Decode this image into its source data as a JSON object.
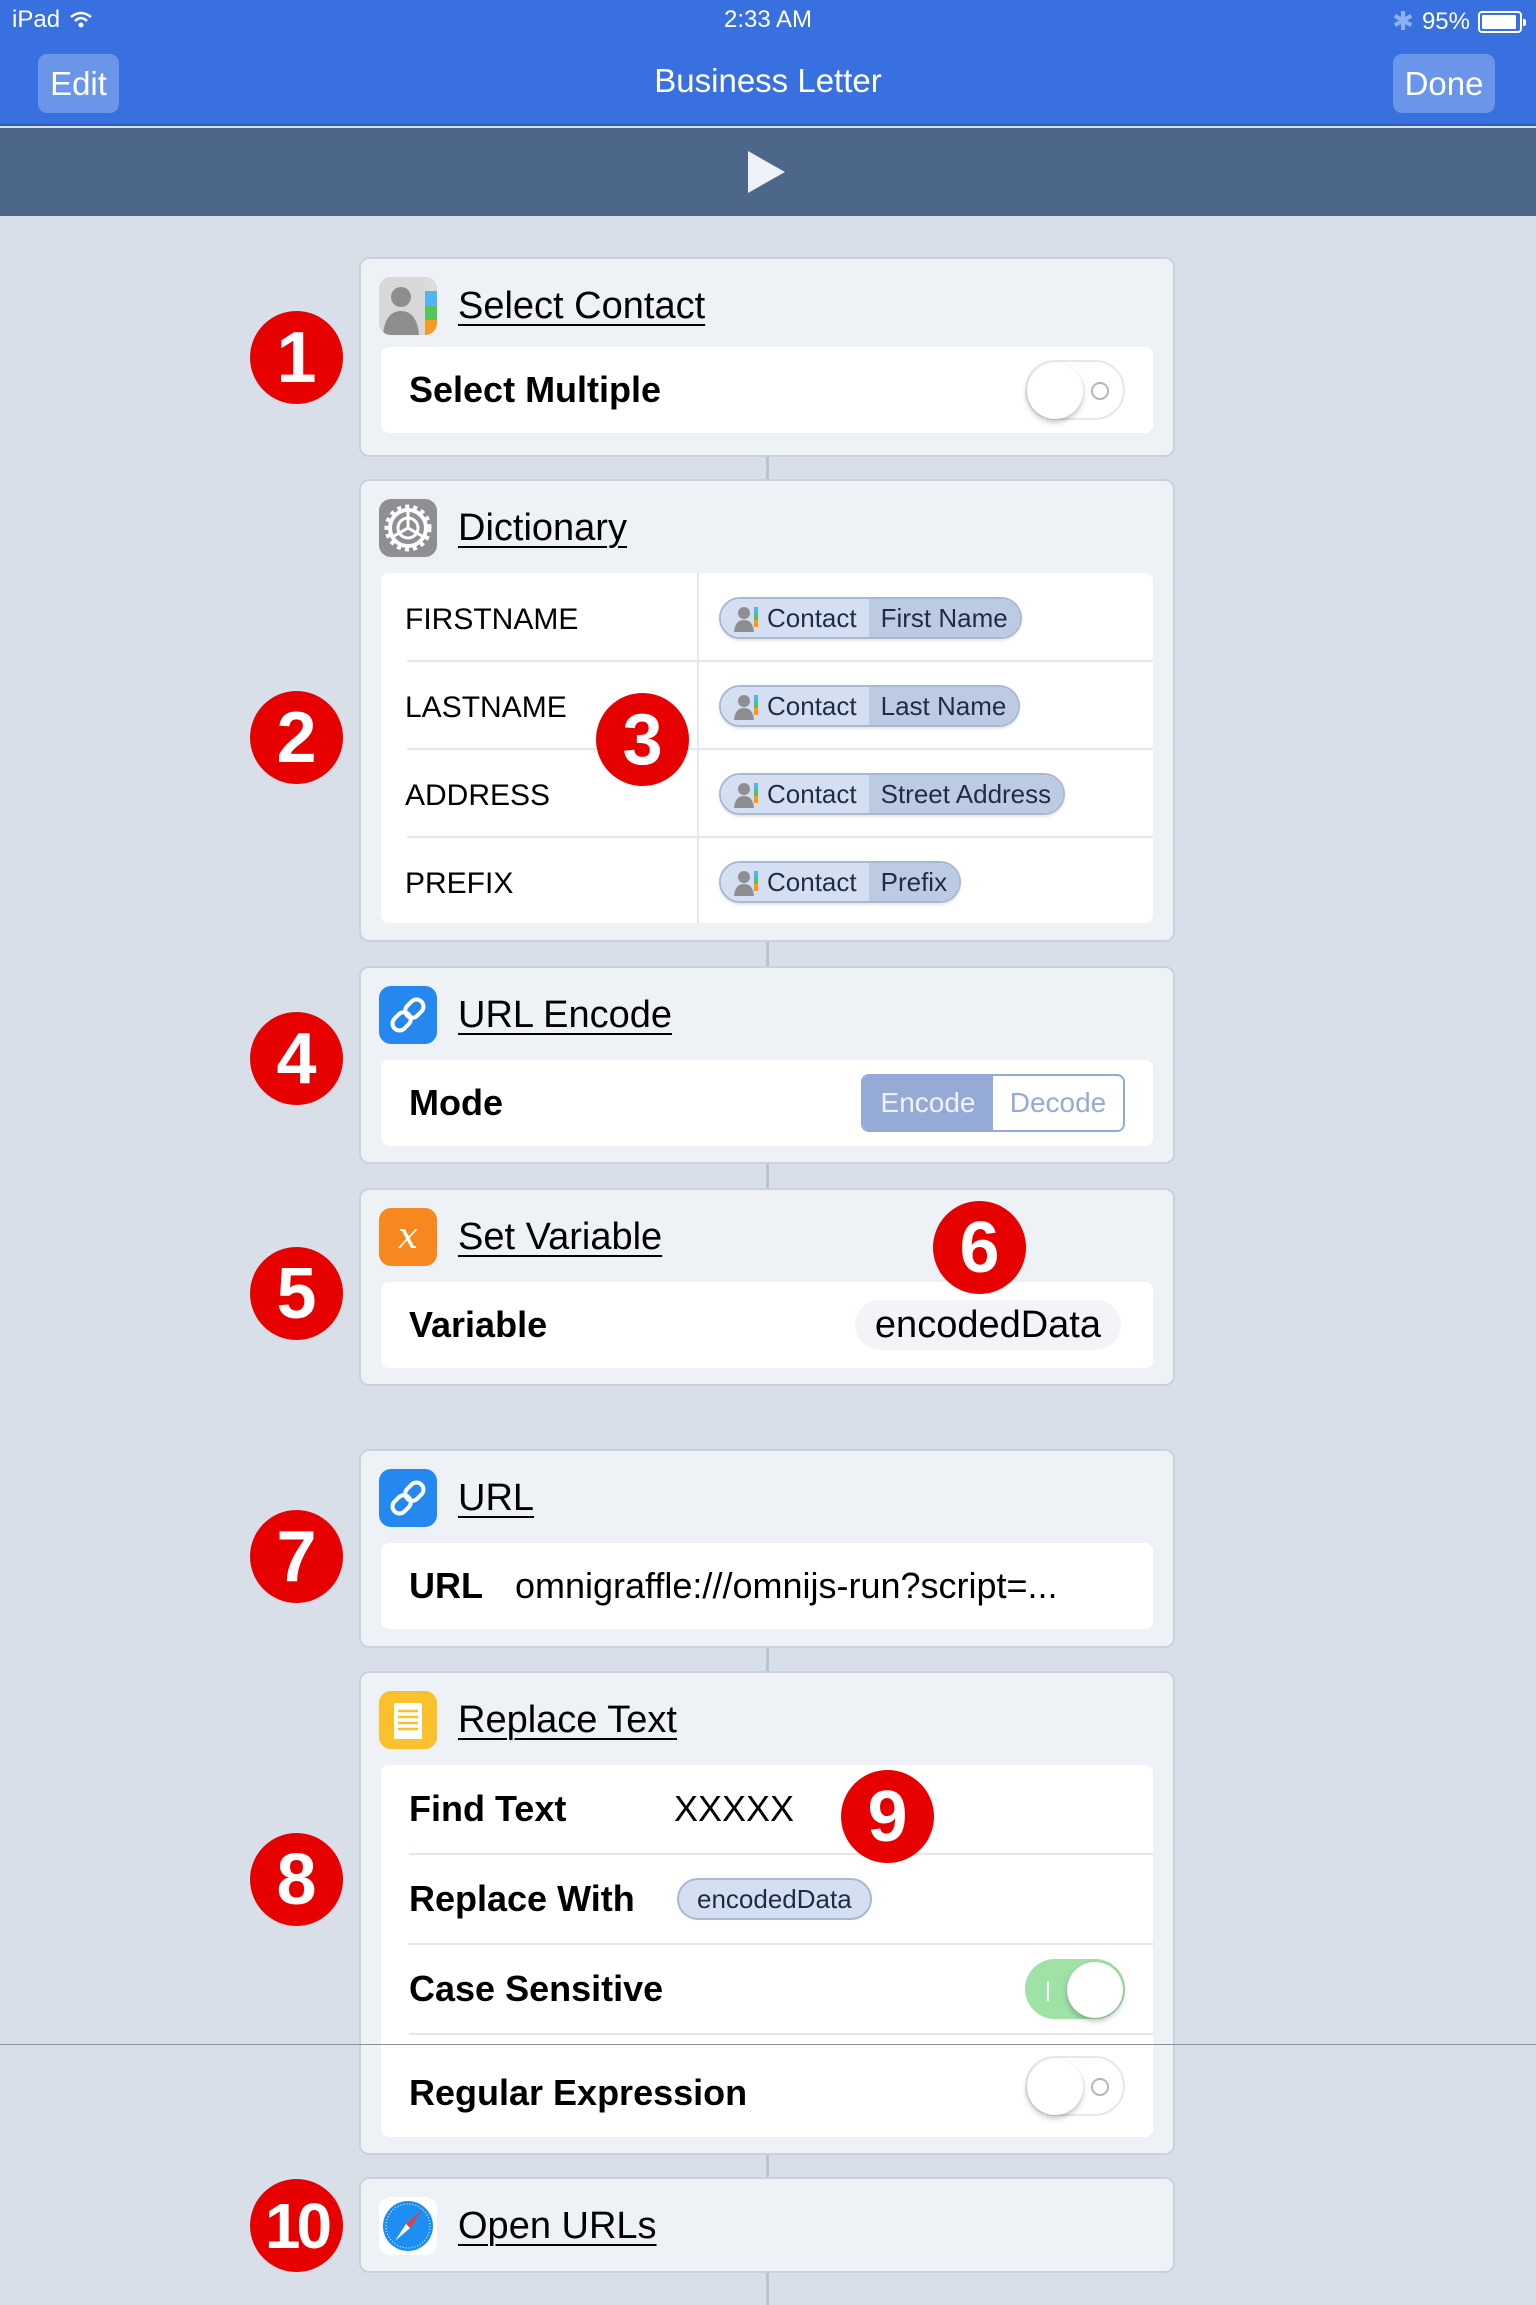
{
  "status_bar": {
    "device": "iPad",
    "time": "2:33 AM",
    "battery": "95%",
    "battery_level": 0.95,
    "icons": [
      "wifi-icon",
      "bluetooth-icon",
      "battery-icon"
    ]
  },
  "nav": {
    "edit_label": "Edit",
    "title": "Business Letter",
    "done_label": "Done"
  },
  "run_bar": {
    "icon": "play-icon"
  },
  "colors": {
    "nav_blue": "#3870df",
    "run_bar": "#4c6789",
    "badge_red": "#e60000",
    "toggle_on": "#9ee2a6",
    "segment_active": "#95abd6"
  },
  "actions": [
    {
      "badge": "1",
      "title": "Select Contact",
      "icon": "contacts-icon",
      "params": [
        {
          "label": "Select Multiple",
          "type": "toggle",
          "on": false
        }
      ]
    },
    {
      "badge": "2",
      "title": "Dictionary",
      "icon": "settings-gear-icon",
      "entries": [
        {
          "key": "FIRSTNAME",
          "source": "Contact",
          "field": "First Name"
        },
        {
          "key": "LASTNAME",
          "source": "Contact",
          "field": "Last Name"
        },
        {
          "key": "ADDRESS",
          "source": "Contact",
          "field": "Street Address"
        },
        {
          "key": "PREFIX",
          "source": "Contact",
          "field": "Prefix"
        }
      ]
    },
    {
      "badge": "4",
      "title": "URL Encode",
      "icon": "link-icon",
      "params": [
        {
          "label": "Mode",
          "type": "segmented",
          "options": [
            "Encode",
            "Decode"
          ],
          "selected": "Encode"
        }
      ]
    },
    {
      "badge": "5",
      "title": "Set Variable",
      "icon": "variable-icon",
      "params": [
        {
          "label": "Variable",
          "value": "encodedData"
        }
      ]
    },
    {
      "badge": "7",
      "title": "URL",
      "icon": "link-icon",
      "params": [
        {
          "label": "URL",
          "value": "omnigraffle:///omnijs-run?script=..."
        }
      ]
    },
    {
      "badge": "8",
      "title": "Replace Text",
      "icon": "notes-icon",
      "params": [
        {
          "label": "Find Text",
          "value": "XXXXX"
        },
        {
          "label": "Replace With",
          "token": "encodedData"
        },
        {
          "label": "Case Sensitive",
          "type": "toggle",
          "on": true
        },
        {
          "label": "Regular Expression",
          "type": "toggle",
          "on": false
        }
      ]
    },
    {
      "badge": "10",
      "title": "Open URLs",
      "icon": "safari-compass-icon"
    }
  ],
  "callouts": [
    {
      "number": "3"
    },
    {
      "number": "6"
    },
    {
      "number": "9"
    }
  ]
}
